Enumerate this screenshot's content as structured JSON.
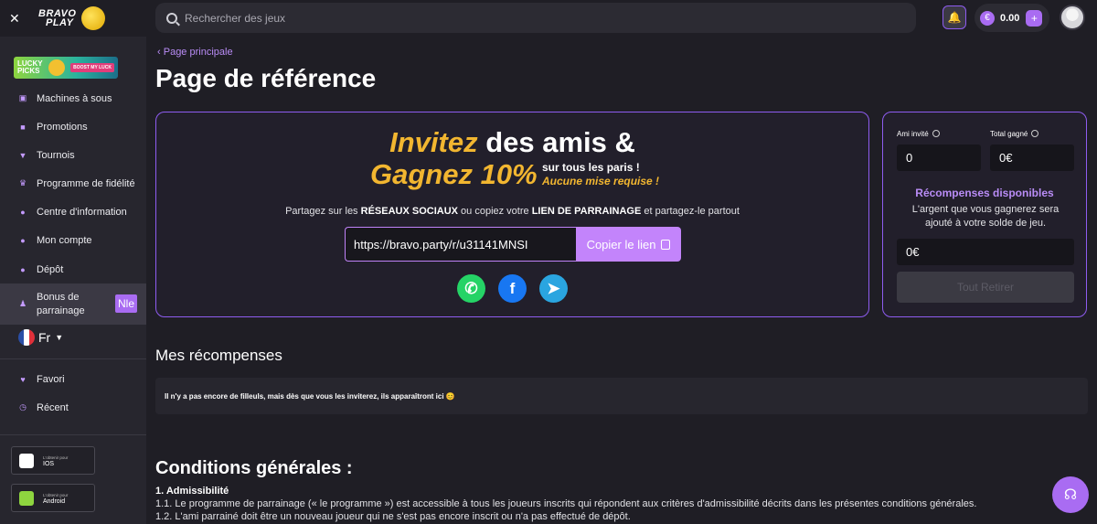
{
  "sidebar": {
    "close": "✕",
    "logo": [
      "BRAVO",
      "PLAY"
    ],
    "lucky": {
      "line1": "LUCKY",
      "line2": "PICKS",
      "boost": "BOOST MY LUCK"
    },
    "items": [
      {
        "label": "Machines à sous",
        "icon": "slot-machine-icon"
      },
      {
        "label": "Promotions",
        "icon": "gift-icon"
      },
      {
        "label": "Tournois",
        "icon": "trophy-icon"
      },
      {
        "label": "Programme de fidélité",
        "icon": "crown-icon"
      },
      {
        "label": "Centre d'information",
        "icon": "info-icon"
      },
      {
        "label": "Mon compte",
        "icon": "user-icon"
      },
      {
        "label": "Dépôt",
        "icon": "deposit-icon"
      },
      {
        "label": "Bonus de parrainage",
        "icon": "referral-icon",
        "badge": "Nle"
      }
    ],
    "language": "Fr",
    "bottom_items": [
      {
        "label": "Favori",
        "icon": "heart-icon"
      },
      {
        "label": "Récent",
        "icon": "clock-icon"
      }
    ],
    "stores": [
      {
        "small": "L'obtenir pour",
        "name": "IOS"
      },
      {
        "small": "L'obtenir pour",
        "name": "Android"
      }
    ]
  },
  "topbar": {
    "search_placeholder": "Rechercher des jeux",
    "currency_symbol": "€",
    "balance": "0.00",
    "plus": "+"
  },
  "main": {
    "breadcrumb": "Page principale",
    "title": "Page de référence",
    "invite": {
      "word_invite": "Invitez",
      "rest_line1": " des amis &",
      "gagnez": "Gagnez 10%",
      "sub1": "sur tous les paris !",
      "sub2": "Aucune mise requise !",
      "desc_a": "Partagez sur les ",
      "desc_b": "RÉSEAUX SOCIAUX",
      "desc_c": " ou copiez votre ",
      "desc_d": "LIEN DE PARRAINAGE",
      "desc_e": " et partagez-le partout",
      "link": "https://bravo.party/r/u31141MNSI",
      "copy_label": "Copier le lien"
    },
    "stats": {
      "invited_label": "Ami invité",
      "invited_value": "0",
      "earned_label": "Total gagné",
      "earned_value": "0€",
      "rewards_title": "Récompenses disponibles",
      "rewards_desc": "L'argent que vous gagnerez sera ajouté à votre solde de jeu.",
      "rewards_value": "0€",
      "withdraw_label": "Tout Retirer"
    },
    "rewards_section": {
      "title": "Mes récompenses",
      "empty": "Il n'y a pas encore de filleuls, mais dès que vous les inviterez, ils apparaîtront ici 😊"
    },
    "conditions": {
      "title": "Conditions générales :",
      "heading": "1. Admissibilité",
      "p1": "1.1. Le programme de parrainage (« le programme ») est accessible à tous les joueurs inscrits qui répondent aux critères d'admissibilité décrits dans les présentes conditions générales.",
      "p2": "1.2. L'ami parrainé doit être un nouveau joueur qui ne s'est pas encore inscrit ou n'a pas effectué de dépôt."
    }
  },
  "colors": {
    "accent": "#a96cf2",
    "gold": "#f2b630",
    "border": "#8e5cf0"
  }
}
